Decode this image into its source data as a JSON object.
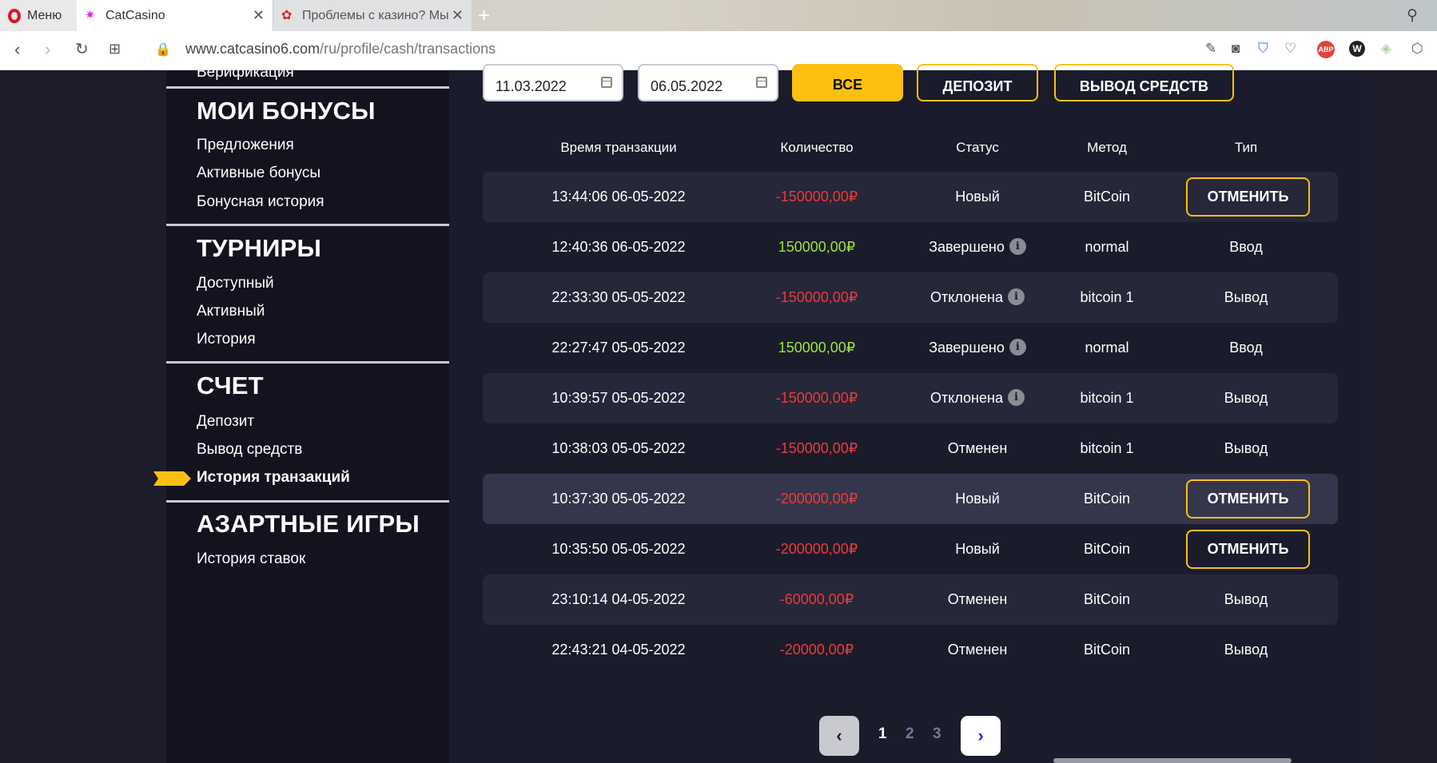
{
  "browser": {
    "menu_label": "Меню",
    "active_tab_title": "CatCasino",
    "inactive_tab_title": "Проблемы с казино? Мы",
    "url_main": "www.catcasino6.com",
    "url_path": "/ru/profile/cash/transactions"
  },
  "sidebar": {
    "top_partial": "Верификация",
    "sections": [
      {
        "heading": "МОИ БОНУСЫ",
        "items": [
          "Предложения",
          "Активные бонусы",
          "Бонусная история"
        ]
      },
      {
        "heading": "ТУРНИРЫ",
        "items": [
          "Доступный",
          "Активный",
          "История"
        ]
      },
      {
        "heading": "СЧЕТ",
        "items": [
          "Депозит",
          "Вывод средств",
          "История транзакций"
        ]
      },
      {
        "heading": "АЗАРТНЫЕ ИГРЫ",
        "items": [
          "История ставок"
        ]
      }
    ]
  },
  "filters": {
    "date_from": "11.03.2022",
    "date_to": "06.05.2022",
    "btn_all": "ВСЕ",
    "btn_deposit": "ДЕПОЗИТ",
    "btn_withdraw": "ВЫВОД СРЕДСТВ"
  },
  "table": {
    "headers": [
      "Время транзакции",
      "Количество",
      "Статус",
      "Метод",
      "Тип"
    ],
    "rows": [
      {
        "time": "13:44:06 06-05-2022",
        "amount": "-150000,00₽",
        "status": "Новый",
        "method": "BitCoin",
        "type": "ОТМЕНИТЬ"
      },
      {
        "time": "12:40:36 06-05-2022",
        "amount": "150000,00₽",
        "status": "Завершено",
        "method": "normal",
        "type": "Ввод"
      },
      {
        "time": "22:33:30 05-05-2022",
        "amount": "-150000,00₽",
        "status": "Отклонена",
        "method": "bitcoin 1",
        "type": "Вывод"
      },
      {
        "time": "22:27:47 05-05-2022",
        "amount": "150000,00₽",
        "status": "Завершено",
        "method": "normal",
        "type": "Ввод"
      },
      {
        "time": "10:39:57 05-05-2022",
        "amount": "-150000,00₽",
        "status": "Отклонена",
        "method": "bitcoin 1",
        "type": "Вывод"
      },
      {
        "time": "10:38:03 05-05-2022",
        "amount": "-150000,00₽",
        "status": "Отменен",
        "method": "bitcoin 1",
        "type": "Вывод"
      },
      {
        "time": "10:37:30 05-05-2022",
        "amount": "-200000,00₽",
        "status": "Новый",
        "method": "BitCoin",
        "type": "ОТМЕНИТЬ"
      },
      {
        "time": "10:35:50 05-05-2022",
        "amount": "-200000,00₽",
        "status": "Новый",
        "method": "BitCoin",
        "type": "ОТМЕНИТЬ"
      },
      {
        "time": "23:10:14 04-05-2022",
        "amount": "-60000,00₽",
        "status": "Отменен",
        "method": "BitCoin",
        "type": "Вывод"
      },
      {
        "time": "22:43:21 04-05-2022",
        "amount": "-20000,00₽",
        "status": "Отменен",
        "method": "BitCoin",
        "type": "Вывод"
      }
    ]
  },
  "pagination": {
    "pages": [
      "1",
      "2",
      "3"
    ],
    "current": "1"
  },
  "colors": {
    "accent": "#fcc013",
    "negative": "#ec3a3a",
    "positive": "#9be43a",
    "background": "#1b1c2b"
  }
}
